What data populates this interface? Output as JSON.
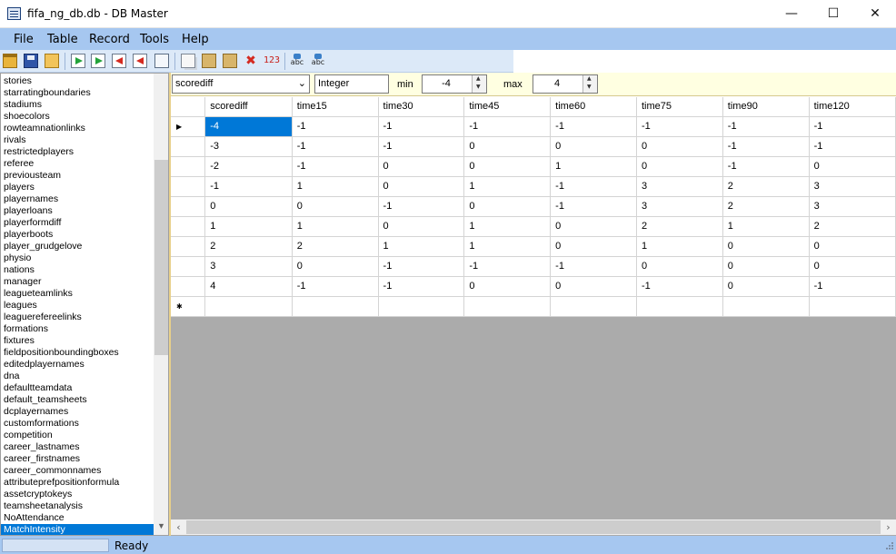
{
  "window": {
    "title": "fifa_ng_db.db - DB Master",
    "minimize": "—",
    "maximize": "☐",
    "close": "✕"
  },
  "menu": [
    "File",
    "Table",
    "Record",
    "Tools",
    "Help"
  ],
  "toolbar": {
    "icons": [
      "open-icon",
      "save-icon",
      "open-folder-icon",
      "import-icon",
      "export-icon",
      "export-red-icon",
      "delete-table-icon",
      "tree-icon",
      "copy-icon",
      "paste-icon",
      "paste-special-icon",
      "delete-record-icon",
      "numeric-icon",
      "spellcheck-icon",
      "spellcheck-alt-icon"
    ],
    "delete_glyph": "✖",
    "numeric_label": "123",
    "abc_label": "abc"
  },
  "tables": [
    "stories",
    "starratingboundaries",
    "stadiums",
    "shoecolors",
    "rowteamnationlinks",
    "rivals",
    "restrictedplayers",
    "referee",
    "previousteam",
    "players",
    "playernames",
    "playerloans",
    "playerformdiff",
    "playerboots",
    "player_grudgelove",
    "physio",
    "nations",
    "manager",
    "leagueteamlinks",
    "leagues",
    "leaguerefereelinks",
    "formations",
    "fixtures",
    "fieldpositionboundingboxes",
    "editedplayernames",
    "dna",
    "defaultteamdata",
    "default_teamsheets",
    "dcplayernames",
    "customformations",
    "competition",
    "career_lastnames",
    "career_firstnames",
    "career_commonnames",
    "attributeprefpositionformula",
    "assetcryptokeys",
    "teamsheetanalysis",
    "NoAttendance",
    "MatchIntensity"
  ],
  "selected_table": "MatchIntensity",
  "filter": {
    "field": "scorediff",
    "type": "Integer",
    "min_label": "min",
    "min_value": "-4",
    "max_label": "max",
    "max_value": "4"
  },
  "grid": {
    "columns": [
      "scorediff",
      "time15",
      "time30",
      "time45",
      "time60",
      "time75",
      "time90",
      "time120"
    ],
    "rows": [
      [
        "-4",
        "-1",
        "-1",
        "-1",
        "-1",
        "-1",
        "-1",
        "-1"
      ],
      [
        "-3",
        "-1",
        "-1",
        "0",
        "0",
        "0",
        "-1",
        "-1"
      ],
      [
        "-2",
        "-1",
        "0",
        "0",
        "1",
        "0",
        "-1",
        "0"
      ],
      [
        "-1",
        "1",
        "0",
        "1",
        "-1",
        "3",
        "2",
        "3"
      ],
      [
        "0",
        "0",
        "-1",
        "0",
        "-1",
        "3",
        "2",
        "3"
      ],
      [
        "1",
        "1",
        "0",
        "1",
        "0",
        "2",
        "1",
        "2"
      ],
      [
        "2",
        "2",
        "1",
        "1",
        "0",
        "1",
        "0",
        "0"
      ],
      [
        "3",
        "0",
        "-1",
        "-1",
        "-1",
        "0",
        "0",
        "0"
      ],
      [
        "4",
        "-1",
        "-1",
        "0",
        "0",
        "-1",
        "0",
        "-1"
      ]
    ],
    "current_row_marker": "▶",
    "new_row_marker": "✱"
  },
  "status": {
    "text": "Ready"
  },
  "colors": {
    "menubar": "#a6c7f0",
    "selection": "#0078d7",
    "filterbar": "#ffffe1",
    "grid_empty": "#ababab"
  }
}
